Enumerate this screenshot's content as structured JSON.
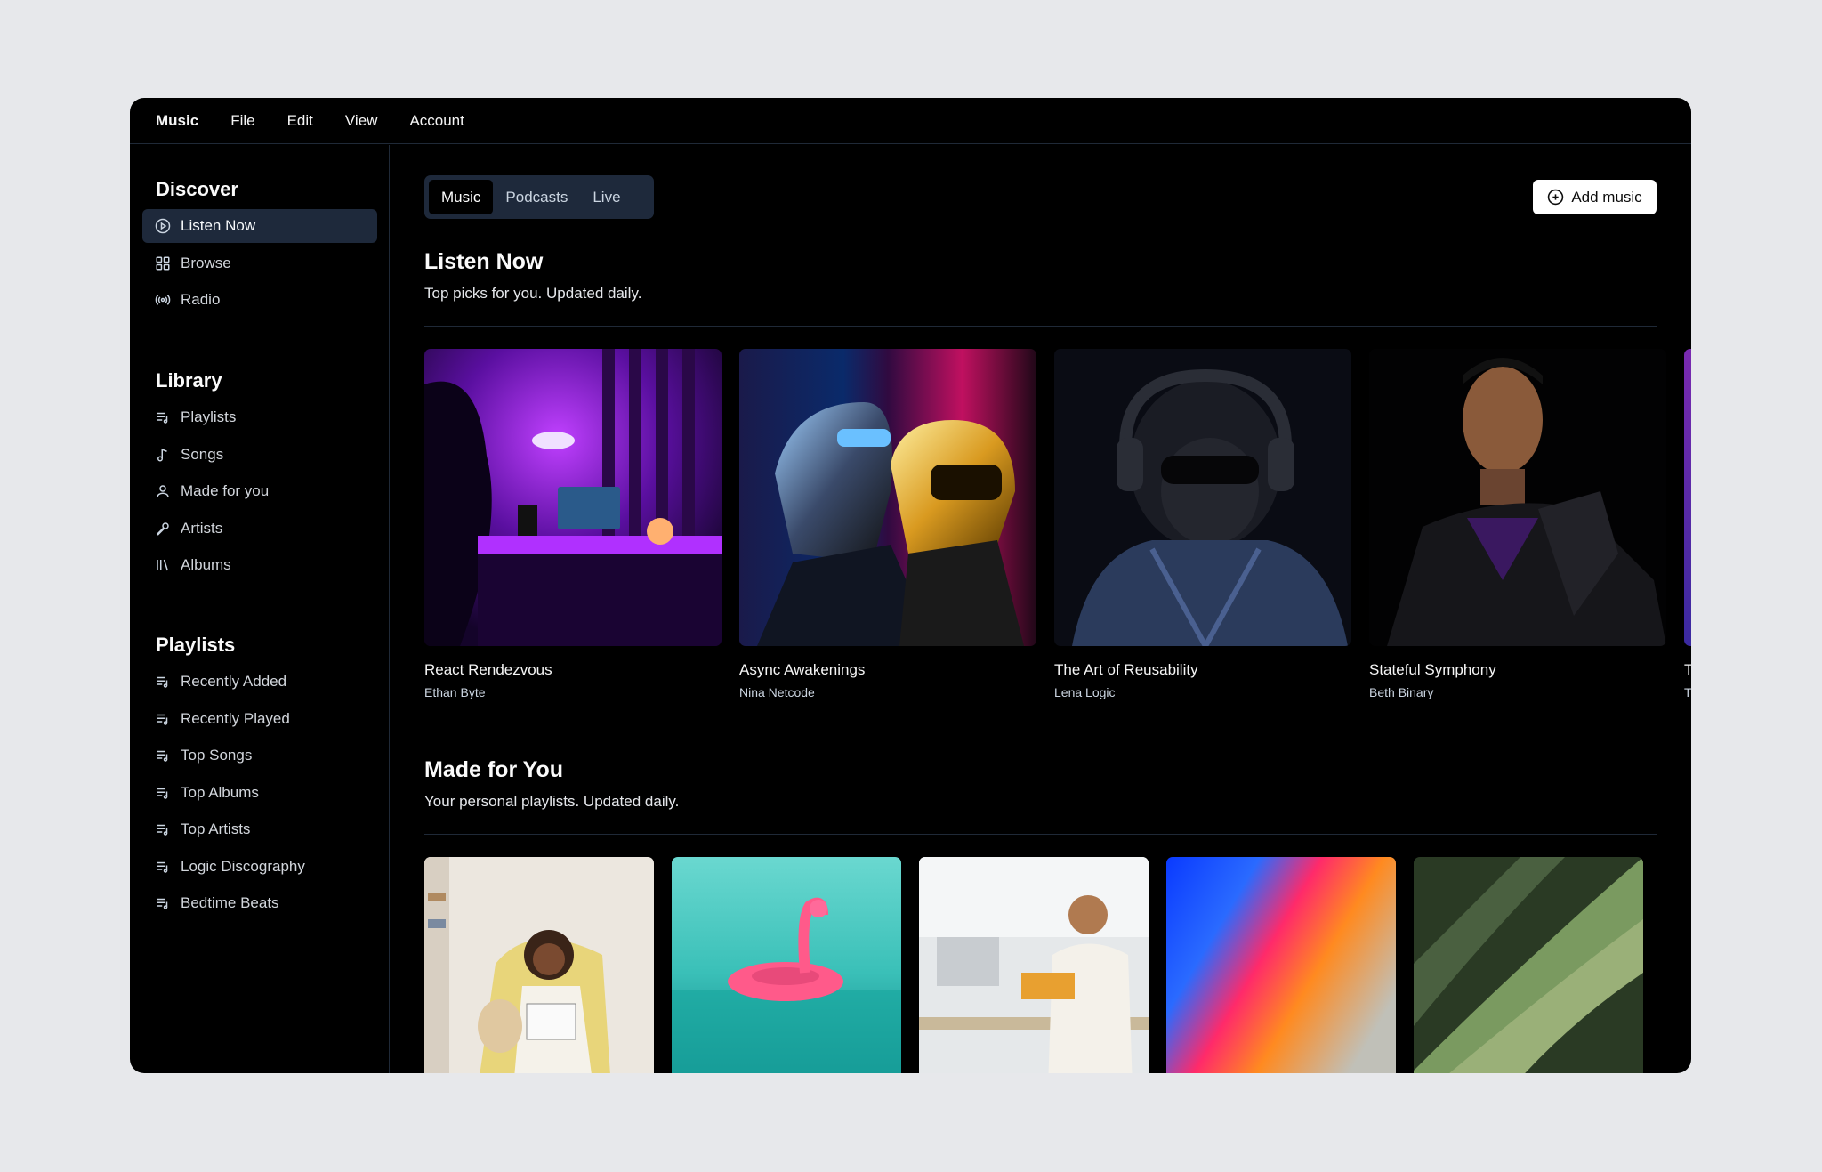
{
  "menubar": {
    "items": [
      "Music",
      "File",
      "Edit",
      "View",
      "Account"
    ]
  },
  "sidebar": {
    "discover": {
      "heading": "Discover",
      "items": [
        {
          "label": "Listen Now",
          "icon": "play-circle-icon",
          "active": true
        },
        {
          "label": "Browse",
          "icon": "grid-icon"
        },
        {
          "label": "Radio",
          "icon": "radio-icon"
        }
      ]
    },
    "library": {
      "heading": "Library",
      "items": [
        {
          "label": "Playlists",
          "icon": "playlist-icon"
        },
        {
          "label": "Songs",
          "icon": "music-note-icon"
        },
        {
          "label": "Made for you",
          "icon": "user-icon"
        },
        {
          "label": "Artists",
          "icon": "microphone-icon"
        },
        {
          "label": "Albums",
          "icon": "library-icon"
        }
      ]
    },
    "playlists": {
      "heading": "Playlists",
      "items": [
        {
          "label": "Recently Added",
          "icon": "playlist-icon"
        },
        {
          "label": "Recently Played",
          "icon": "playlist-icon"
        },
        {
          "label": "Top Songs",
          "icon": "playlist-icon"
        },
        {
          "label": "Top Albums",
          "icon": "playlist-icon"
        },
        {
          "label": "Top Artists",
          "icon": "playlist-icon"
        },
        {
          "label": "Logic Discography",
          "icon": "playlist-icon"
        },
        {
          "label": "Bedtime Beats",
          "icon": "playlist-icon"
        }
      ]
    }
  },
  "main": {
    "tabs": [
      {
        "label": "Music",
        "active": true
      },
      {
        "label": "Podcasts"
      },
      {
        "label": "Live"
      }
    ],
    "add_button": {
      "label": "Add music",
      "icon": "plus-circle-icon"
    },
    "listen_now": {
      "title": "Listen Now",
      "subtitle": "Top picks for you. Updated daily.",
      "albums": [
        {
          "title": "React Rendezvous",
          "artist": "Ethan Byte"
        },
        {
          "title": "Async Awakenings",
          "artist": "Nina Netcode"
        },
        {
          "title": "The Art of Reusability",
          "artist": "Lena Logic"
        },
        {
          "title": "Stateful Symphony",
          "artist": "Beth Binary"
        },
        {
          "title": "T",
          "artist": "T"
        }
      ]
    },
    "made_for_you": {
      "title": "Made for You",
      "subtitle": "Your personal playlists. Updated daily."
    }
  },
  "colors": {
    "window_bg": "#000000",
    "page_bg": "#e7e8eb",
    "active_bg": "#1e293b",
    "divider": "#1f2937"
  }
}
